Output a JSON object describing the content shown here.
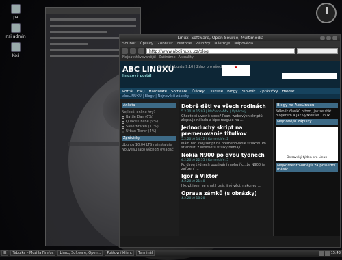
{
  "desktop": {
    "icons": [
      {
        "label": "pa"
      },
      {
        "label": "nsi\nadmin"
      },
      {
        "label": "Koš"
      }
    ]
  },
  "browser": {
    "title": "Linux, Software, Open Source, Multimedia",
    "menu": [
      "Soubor",
      "Úpravy",
      "Zobrazit",
      "Historie",
      "Záložky",
      "Nástroje",
      "Nápověda"
    ],
    "url": "http://www.abclinuxu.cz/blog",
    "bookmarks": [
      "Nejnavštěvovanější",
      "Začínáme",
      "Aktuality"
    ],
    "site": {
      "logo": "ABC LINUXU",
      "logo_sub": "linuxový portál",
      "tagline": "Stabilní Ubuntu 9.10 | Zdroj pro všechny",
      "nav": [
        "Portál",
        "FAQ",
        "Hardware",
        "Software",
        "Články",
        "Diskuse",
        "Blogy",
        "Slovník",
        "Zprávičky",
        "Hledat",
        "Vyhledat"
      ],
      "sub": "abcLINUXU | Blogy | Nejnovější zápisky"
    },
    "left": {
      "heading": "Anketa",
      "question": "Nejlepší online hry?",
      "options": [
        "Battle Dan (6%)",
        "Quake Online (9%)",
        "Sauerbraten (17%)",
        "Urban Terror (4%)"
      ],
      "heading2": "Zprávičky",
      "news": "Ubuntu 10.04 LTS nainstaluje Nouveau jako výchozí ovladač"
    },
    "articles": [
      {
        "title": "Dobrě děti ve všech rodinách",
        "meta": "5.2.2010 15:03 | Přečteno 44× | Výběrový",
        "text": "Chcete si uvolnit stres? Psaní webových skriptů zlepšuje náladu a lépe reaguje na ..."
      },
      {
        "title": "Jednoduchý skript na premenovanie titulkov",
        "meta": "5.2.2010 14:12 | Komentáře: 2",
        "text": "Mám rad svoj skript na premenovanie titulkov. Po stiahnutí z internetu titulky nemajú ..."
      },
      {
        "title": "Nokia N900 po dvou týdnech",
        "meta": "4.2.2010 22:55 | Komentáře: 5",
        "text": "Po dvou týdnech používání mohu říci, že N900 je zařízení ..."
      },
      {
        "title": "Igor a Viktor",
        "meta": "4.2.2010 21:40",
        "text": "I když jsem se snažil psát jiné věci, nakonec ..."
      },
      {
        "title": "Oprava zámků (s obrázky)",
        "meta": "4.2.2010 18:20",
        "text": ""
      }
    ],
    "right": {
      "box1": "Blogy na AbcLinuxu",
      "text1": "Několik článků o tom, jak se stát blogerem a jak vyzkoušet Linux.",
      "box2": "Nejnovější zápisky",
      "ad": "Ostravský týden pro Linux",
      "box3": "Nejkomentovanější za poslední měsíc"
    }
  },
  "taskbar": {
    "items": [
      "Tabulka – Mozilla Firefox",
      "Linux, Software, Open...",
      "Poštovní klient",
      "Terminál"
    ],
    "clock": "15:43"
  }
}
